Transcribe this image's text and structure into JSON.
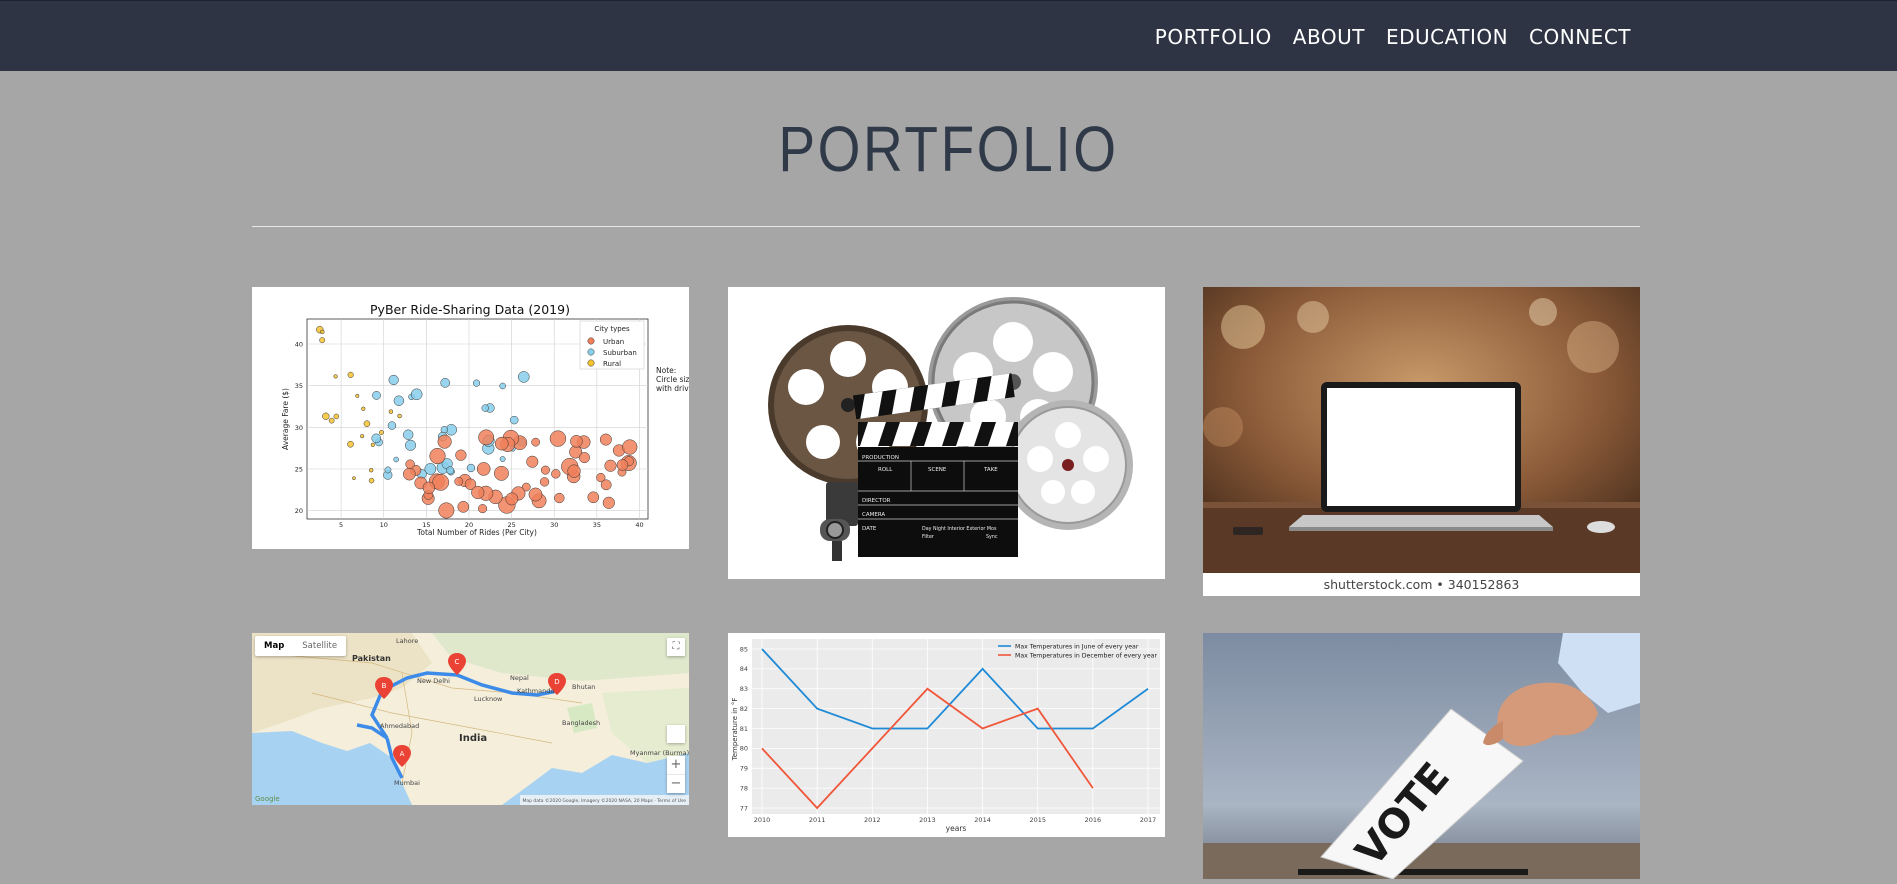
{
  "nav": {
    "links": [
      "PORTFOLIO",
      "ABOUT",
      "EDUCATION",
      "CONNECT"
    ]
  },
  "page": {
    "title": "PORTFOLIO"
  },
  "colors": {
    "navbar": "#2e3444",
    "background": "#a6a6a6",
    "urban": "#f0805a",
    "suburban": "#87ceeb",
    "rural": "#f5c230",
    "june_line": "#1f8ad6",
    "december_line": "#f0563a",
    "route": "#4a90e2"
  },
  "pyber": {
    "title": "PyBer Ride-Sharing Data (2019)",
    "xlabel": "Total Number of Rides (Per City)",
    "ylabel": "Average Fare ($)",
    "legend_title": "City types",
    "legend": [
      "Urban",
      "Suburban",
      "Rural"
    ],
    "note_line1": "Note:",
    "note_line2": "Circle size",
    "note_line3": "with driver",
    "x_ticks": [
      "5",
      "10",
      "15",
      "20",
      "25",
      "30",
      "35",
      "40"
    ],
    "y_ticks": [
      "20",
      "25",
      "30",
      "35",
      "40"
    ]
  },
  "film": {
    "slate_rows": [
      "PRODUCTION",
      "ROLL",
      "SCENE",
      "TAKE",
      "DIRECTOR",
      "CAMERA",
      "DATE",
      "Day Night Interior Exterior Mos",
      "Filter",
      "Sync"
    ]
  },
  "laptop": {
    "caption": "shutterstock.com • 340152863"
  },
  "map": {
    "map_tab": "Map",
    "satellite_tab": "Satellite",
    "labels": [
      "Lahore",
      "Pakistan",
      "New Delhi",
      "India",
      "Nepal",
      "Kathmandu",
      "Lucknow",
      "Bhutan",
      "Bangladesh",
      "Ahmedabad",
      "Myanmar (Burma)",
      "Mumbai"
    ],
    "zoom_in": "+",
    "zoom_out": "−",
    "google": "Google",
    "attribution": "Map data ©2020 Google, Imagery ©2020 NASA, 20 Maps · Terms of Use",
    "markers": [
      "A",
      "B",
      "C",
      "D"
    ]
  },
  "vote": {
    "text": "VOTE"
  },
  "chart_data": {
    "type": "line",
    "x": [
      2010,
      2011,
      2012,
      2013,
      2014,
      2015,
      2016,
      2017
    ],
    "series": [
      {
        "name": "Max Temperatures in June of every year",
        "values": [
          85,
          82,
          81,
          81,
          84,
          81,
          81,
          83
        ]
      },
      {
        "name": "Max Temperatures in December of every year",
        "values": [
          80,
          77,
          80,
          83,
          81,
          82,
          78,
          null
        ]
      }
    ],
    "xlabel": "years",
    "ylabel": "Temperature in °F",
    "ylim": [
      77,
      85
    ],
    "y_ticks": [
      "77",
      "78",
      "79",
      "80",
      "81",
      "82",
      "83",
      "84",
      "85"
    ],
    "x_ticks": [
      "2010",
      "2011",
      "2012",
      "2013",
      "2014",
      "2015",
      "2016",
      "2017"
    ],
    "grid": true,
    "legend_position": "top-right"
  }
}
